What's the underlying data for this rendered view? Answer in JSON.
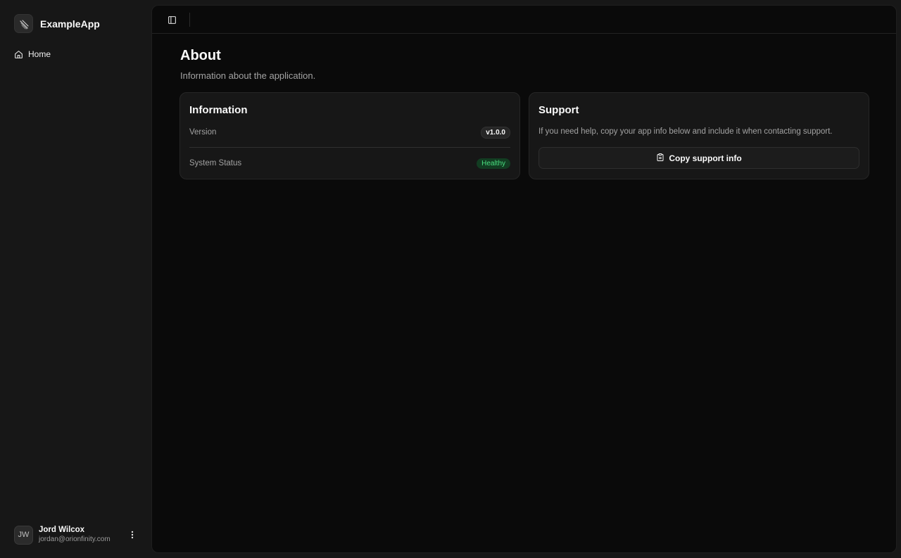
{
  "sidebar": {
    "brand": {
      "name": "ExampleApp",
      "logo_icon": "brand-logo-icon"
    },
    "nav": [
      {
        "label": "Home",
        "icon": "home-icon"
      }
    ],
    "user": {
      "initials": "JW",
      "name": "Jord Wilcox",
      "email": "jordan@orionfinity.com",
      "menu_icon": "more-vertical-icon"
    }
  },
  "topbar": {
    "toggle_icon": "sidebar-toggle-icon"
  },
  "page": {
    "title": "About",
    "subtitle": "Information about the application."
  },
  "info_card": {
    "title": "Information",
    "rows": [
      {
        "label": "Version",
        "value": "v1.0.0"
      },
      {
        "label": "System Status",
        "value": "Healthy",
        "status_color": "#4ade80"
      }
    ]
  },
  "support_card": {
    "title": "Support",
    "description": "If you need help, copy your app info below and include it when contacting support.",
    "button_label": "Copy support info",
    "button_icon": "clipboard-icon"
  },
  "colors": {
    "background": "#0a0a0a",
    "sidebar": "#171717",
    "card": "#171717",
    "healthy": "#4ade80"
  }
}
